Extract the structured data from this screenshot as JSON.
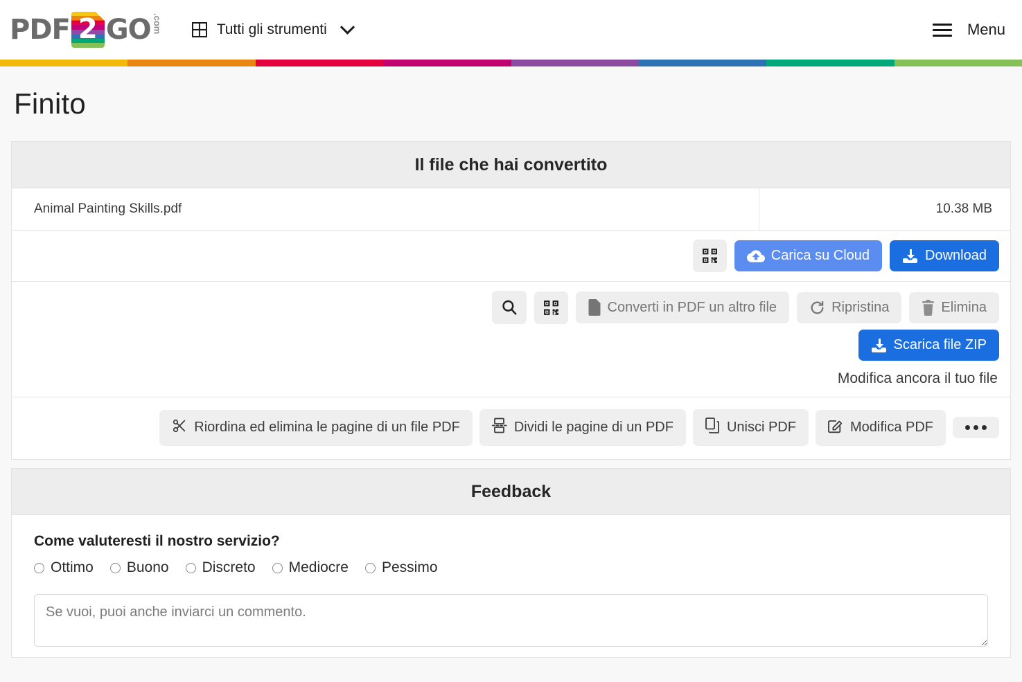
{
  "header": {
    "logo": {
      "left": "PDF",
      "badge": "2",
      "right": "GO",
      "suffix": ".com"
    },
    "tools_label": "Tutti gli strumenti",
    "menu_label": "Menu"
  },
  "rainbow_colors": [
    "#f2b90b",
    "#e8860f",
    "#e4003c",
    "#c2006e",
    "#8a4ba0",
    "#2f72b3",
    "#00a87a",
    "#86c157"
  ],
  "page": {
    "title": "Finito"
  },
  "file_card": {
    "title": "Il file che hai convertito",
    "file_name": "Animal Painting Skills.pdf",
    "file_size": "10.38 MB",
    "qr_button_label": "",
    "cloud_button_label": "Carica su Cloud",
    "download_button_label": "Download",
    "search_button_label": "",
    "convert_other_label": "Converti in PDF un altro file",
    "restore_label": "Ripristina",
    "delete_label": "Elimina",
    "zip_label": "Scarica file ZIP",
    "edit_more_label": "Modifica ancora il tuo file",
    "tools": [
      {
        "label": "Riordina ed elimina le pagine di un file PDF",
        "icon": "scissors-icon"
      },
      {
        "label": "Dividi le pagine di un PDF",
        "icon": "split-icon"
      },
      {
        "label": "Unisci PDF",
        "icon": "merge-icon"
      },
      {
        "label": "Modifica PDF",
        "icon": "edit-icon"
      }
    ],
    "more_label": "•••"
  },
  "feedback": {
    "title": "Feedback",
    "question": "Come valuteresti il nostro servizio?",
    "options": [
      "Ottimo",
      "Buono",
      "Discreto",
      "Mediocre",
      "Pessimo"
    ],
    "comment_placeholder": "Se vuoi, puoi anche inviarci un commento."
  },
  "colors": {
    "primary_blue": "#1b6ee0",
    "light_blue": "#5a8def",
    "grey_button": "#eeeeee",
    "card_head": "#ededed"
  }
}
